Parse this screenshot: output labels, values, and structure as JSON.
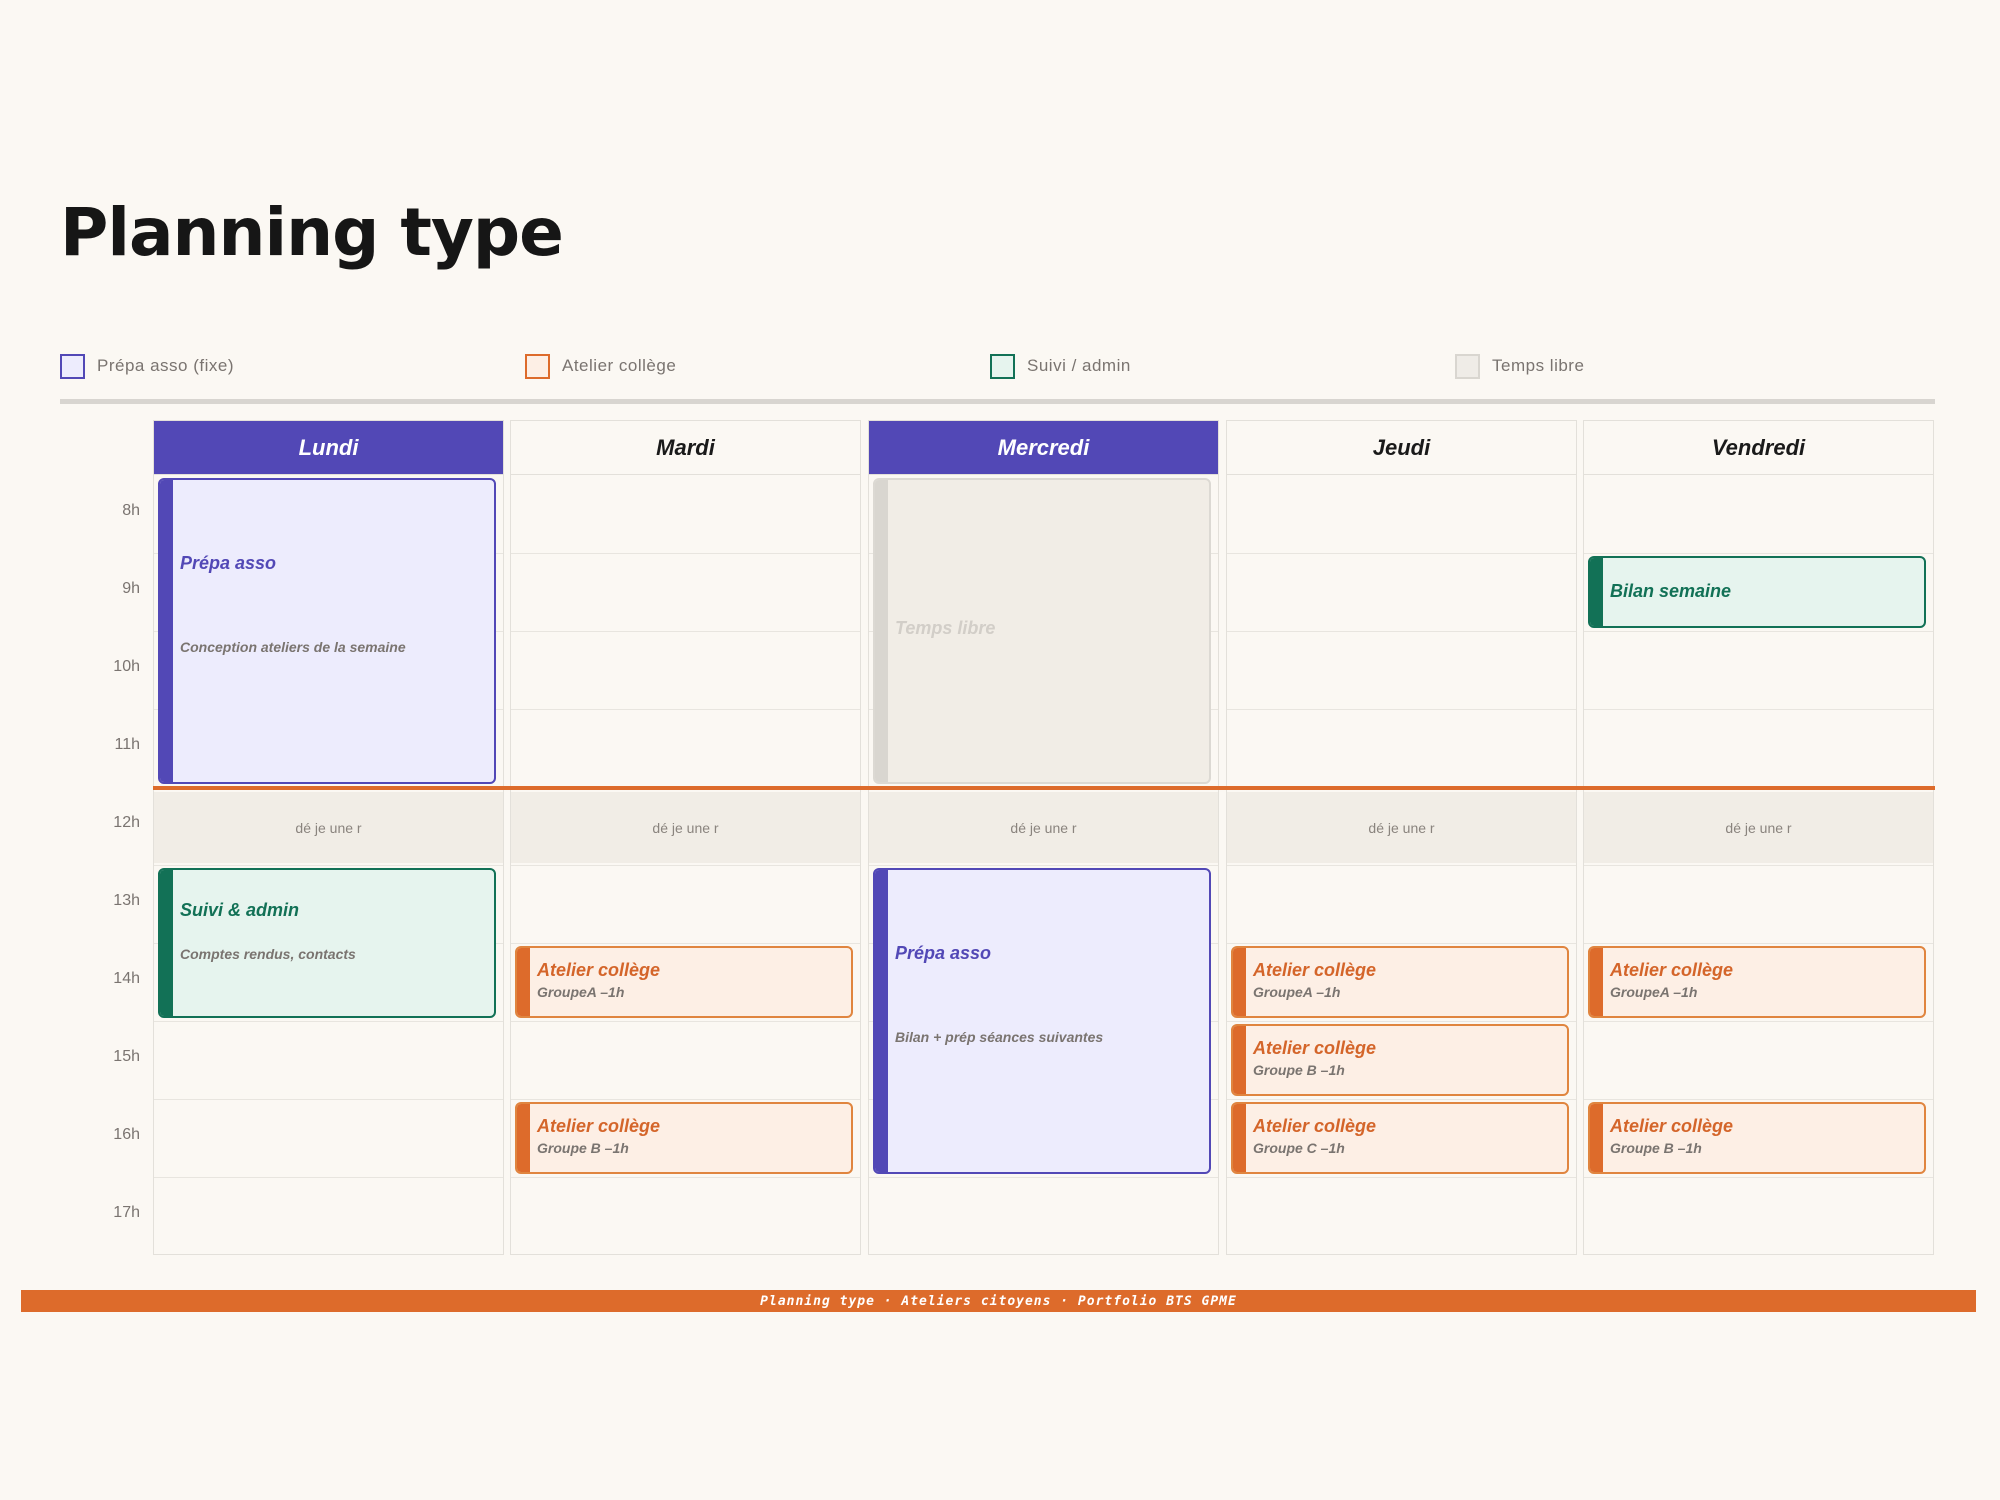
{
  "title": "Planning type",
  "colors": {
    "prepa": "#5248b6",
    "atelier": "#dd6b2b",
    "suivi": "#127156",
    "libre": "#d9d6d0"
  },
  "legend": [
    {
      "label": "Prépa asso (fixe)",
      "kind": "prepa"
    },
    {
      "label": "Atelier collège",
      "kind": "atelier"
    },
    {
      "label": "Suivi / admin",
      "kind": "suivi"
    },
    {
      "label": "Temps libre",
      "kind": "libre"
    }
  ],
  "hours": [
    "8h",
    "9h",
    "10h",
    "11h",
    "12h",
    "13h",
    "14h",
    "15h",
    "16h",
    "17h"
  ],
  "lunch_label": "dé je une r",
  "days": [
    {
      "name": "Lundi",
      "highlight": true,
      "events": [
        {
          "kind": "prepa",
          "start": 8,
          "end": 12,
          "title": "Prépa asso",
          "subtitle": "Conception ateliers de la semaine"
        },
        {
          "kind": "suivi",
          "start": 13,
          "end": 15,
          "title": "Suivi & admin",
          "subtitle": "Comptes rendus, contacts"
        }
      ]
    },
    {
      "name": "Mardi",
      "highlight": false,
      "events": [
        {
          "kind": "atelier",
          "start": 14,
          "end": 15,
          "title": "Atelier collège",
          "subtitle": "GroupeA –1h"
        },
        {
          "kind": "atelier",
          "start": 16,
          "end": 17,
          "title": "Atelier collège",
          "subtitle": "Groupe B –1h"
        }
      ]
    },
    {
      "name": "Mercredi",
      "highlight": true,
      "events": [
        {
          "kind": "libre",
          "start": 8,
          "end": 12,
          "title": "Temps libre",
          "subtitle": ""
        },
        {
          "kind": "prepa",
          "start": 13,
          "end": 17,
          "title": "Prépa asso",
          "subtitle": "Bilan + prép séances suivantes"
        }
      ]
    },
    {
      "name": "Jeudi",
      "highlight": false,
      "events": [
        {
          "kind": "atelier",
          "start": 14,
          "end": 15,
          "title": "Atelier collège",
          "subtitle": "GroupeA –1h"
        },
        {
          "kind": "atelier",
          "start": 15,
          "end": 16,
          "title": "Atelier collège",
          "subtitle": "Groupe B –1h"
        },
        {
          "kind": "atelier",
          "start": 16,
          "end": 17,
          "title": "Atelier collège",
          "subtitle": "Groupe C –1h"
        }
      ]
    },
    {
      "name": "Vendredi",
      "highlight": false,
      "events": [
        {
          "kind": "suivi",
          "start": 9,
          "end": 10,
          "title": "Bilan semaine",
          "subtitle": ""
        },
        {
          "kind": "atelier",
          "start": 14,
          "end": 15,
          "title": "Atelier collège",
          "subtitle": "GroupeA –1h"
        },
        {
          "kind": "atelier",
          "start": 16,
          "end": 17,
          "title": "Atelier collège",
          "subtitle": "Groupe B –1h"
        }
      ]
    }
  ],
  "footer": "Planning type · Ateliers citoyens · Portfolio BTS GPME"
}
